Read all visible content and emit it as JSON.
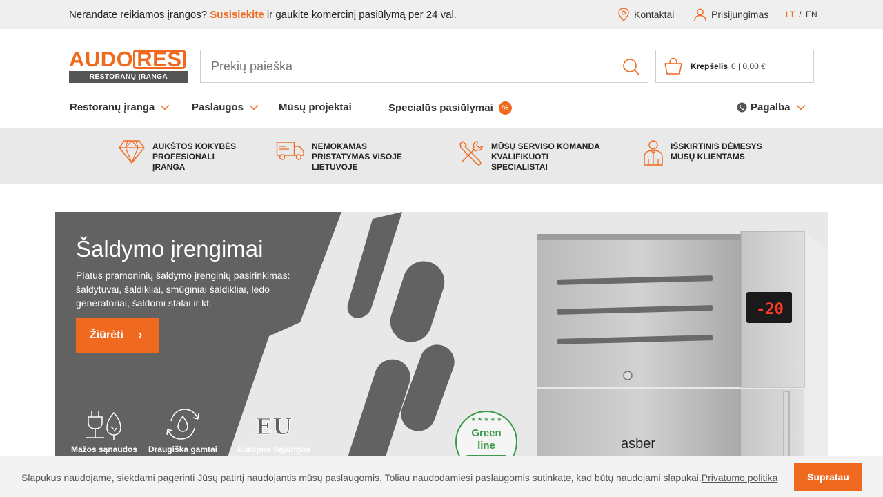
{
  "topbar": {
    "promo_prefix": "Nerandate reikiamos įrangos?",
    "promo_link": "Susisiekite",
    "promo_suffix": "ir gaukite komercinį pasiūlymą per 24 val.",
    "contacts": "Kontaktai",
    "login": "Prisijungimas",
    "lang_active": "LT",
    "lang_sep": "/",
    "lang_other": "EN"
  },
  "brand": {
    "logo_main": "AUDO",
    "logo_accent": "RES",
    "logo_sub": "RESTORANŲ ĮRANGA",
    "accent_color": "#ef6a1f"
  },
  "search": {
    "placeholder": "Prekių paieška",
    "value": ""
  },
  "cart": {
    "label": "Krepšelis",
    "summary": "0 | 0,00 €"
  },
  "nav": {
    "items": [
      {
        "label": "Restoranų įranga",
        "has_dropdown": true
      },
      {
        "label": "Paslaugos",
        "has_dropdown": true
      },
      {
        "label": "Mūsų projektai",
        "has_dropdown": false
      },
      {
        "label": "Specialūs pasiūlymai",
        "badge": "%"
      }
    ],
    "help": "Pagalba"
  },
  "features": [
    {
      "icon": "diamond-icon",
      "text": "AUKŠTOS KOKYBĖS PROFESIONALI ĮRANGA"
    },
    {
      "icon": "truck-icon",
      "text": "NEMOKAMAS PRISTATYMAS VISOJE LIETUVOJE"
    },
    {
      "icon": "tools-icon",
      "text": "MŪSŲ SERVISO KOMANDA KVALIFIKUOTI SPECIALISTAI"
    },
    {
      "icon": "person-icon",
      "text": "IŠSKIRTINIS DĖMESYS MŪSŲ KLIENTAMS"
    }
  ],
  "hero": {
    "title": "Šaldymo įrengimai",
    "description": "Platus pramoninių šaldymo įrenginių pasirinkimas: šaldytuvai, šaldikliai, smūginiai šaldikliai, ledo generatoriai, šaldomi stalai ir kt.",
    "cta": "Žiūrėti",
    "cta_arrow": "›",
    "badges": [
      {
        "icon": "plug-eco-icon",
        "label": "Mažos sąnaudos"
      },
      {
        "icon": "recycle-drop-icon",
        "label": "Draugiška gamtai"
      },
      {
        "icon": "eu-icon",
        "label": "Europos Sąjungos normatyvai",
        "glyph": "EU"
      }
    ],
    "product": {
      "brand": "asber",
      "display": "-20",
      "eco_badge_line1": "Green",
      "eco_badge_line2": "line"
    }
  },
  "cookie": {
    "message": "Slapukus naudojame, siekdami pagerinti Jūsų patirtį naudojantis mūsų paslaugomis. Toliau naudodamiesi paslaugomis sutinkate, kad būtų naudojami slapukai.",
    "policy_link": "Privatumo politika",
    "accept": "Supratau"
  }
}
